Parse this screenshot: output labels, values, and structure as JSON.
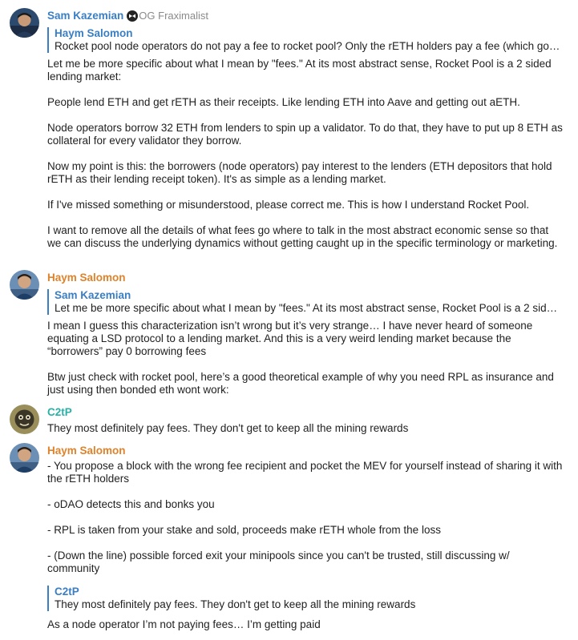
{
  "colors": {
    "sam": "#3a7ec4",
    "haym": "#e0822a",
    "c2tp": "#2bb0a6",
    "quote_bar": "#3a7ec4",
    "badge_text": "#8a8a8a"
  },
  "messages": [
    {
      "author": "Sam Kazemian",
      "badge": "OG Fraximalist",
      "badge_icon": "bowtie-icon",
      "reply": {
        "author": "Haym Salomon",
        "text": "Rocket pool node operators do not pay a fee to rocket pool? Only the rETH holders pay a fee (which go…"
      },
      "paragraphs": [
        "Let me be more specific about what I mean by \"fees.\" At its most abstract sense, Rocket Pool is a 2 sided lending market:",
        "People lend ETH and get rETH as their receipts. Like lending ETH into Aave and getting out aETH.",
        "Node operators borrow 32 ETH from lenders to spin up a validator. To do that, they have to put up 8 ETH as collateral for every validator they borrow.",
        "Now my point is this: the borrowers (node operators) pay interest to the lenders (ETH depositors that hold rETH as their lending receipt token). It's as simple as a lending market.",
        "If I've missed something or misunderstood, please correct me. This is how I understand Rocket Pool.",
        "I want to remove all the details of what fees go where to talk in the most abstract economic sense so that we can discuss the underlying dynamics without getting caught up in the specific terminology or marketing."
      ]
    },
    {
      "author": "Haym Salomon",
      "reply": {
        "author": "Sam Kazemian",
        "text": "Let me be more specific about what I mean by \"fees.\" At its most abstract sense, Rocket Pool is a 2 sid…"
      },
      "paragraphs": [
        "I mean I guess this characterization isn’t wrong but it’s very strange… I have never heard of someone equating a LSD protocol to a lending market. And this is a very weird lending market because the “borrowers” pay 0 borrowing fees",
        "Btw just check with rocket pool, here’s a good theoretical example of why you need RPL as insurance and just using then bonded eth wont work:"
      ]
    },
    {
      "author": "C2tP",
      "paragraphs": [
        "They most definitely pay fees. They don't get to keep all the mining rewards"
      ]
    },
    {
      "author": "Haym Salomon",
      "paragraphs": [
        "- You propose a block with the wrong fee recipient and pocket the MEV for yourself instead of sharing it with the rETH holders",
        "- oDAO detects this and bonks you",
        "- RPL is taken from your stake and sold, proceeds make rETH whole from the loss",
        "- (Down the line) possible forced exit your minipools since you can't be trusted, still discussing w/ community"
      ],
      "reply_after": {
        "author": "C2tP",
        "text": "They most definitely pay fees. They don't get to keep all the mining rewards"
      },
      "final": "As a node operator I’m not paying fees… I’m getting paid"
    }
  ]
}
